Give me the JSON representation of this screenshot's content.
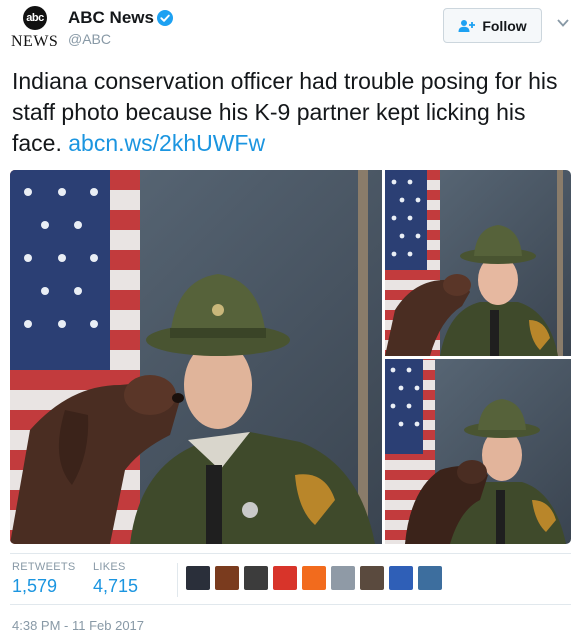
{
  "author": {
    "display_name": "ABC News",
    "handle": "@ABC",
    "avatar_logo_text": "abc",
    "avatar_wordmark": "NEWS",
    "verified_icon": "verified-badge-icon"
  },
  "follow_button": {
    "label": "Follow",
    "icon": "add-user-icon"
  },
  "menu_icon": "chevron-down-icon",
  "tweet": {
    "text": "Indiana conservation officer had trouble posing for his staff photo because his K-9 partner kept licking his face.",
    "link": "abcn.ws/2khUWFw"
  },
  "media": {
    "photo_count": 3,
    "description_icons": [
      "flag-icon",
      "officer-icon",
      "dog-icon"
    ]
  },
  "stats": {
    "retweets_label": "RETWEETS",
    "retweets_value": "1,579",
    "likes_label": "LIKES",
    "likes_value": "4,715"
  },
  "likers": [
    {
      "color": "#2a2f3a"
    },
    {
      "color": "#7a3b1e"
    },
    {
      "color": "#3c3c3c"
    },
    {
      "color": "#d8342a"
    },
    {
      "color": "#f26b1d"
    },
    {
      "color": "#8f9aa6"
    },
    {
      "color": "#5a4a3e"
    },
    {
      "color": "#2f5fb7"
    },
    {
      "color": "#3d6e9e"
    }
  ],
  "timestamp": "4:38 PM - 11 Feb 2017",
  "colors": {
    "link": "#1b95e0",
    "muted": "#8899a6",
    "border": "#e1e8ed",
    "verified": "#1da1f2"
  }
}
